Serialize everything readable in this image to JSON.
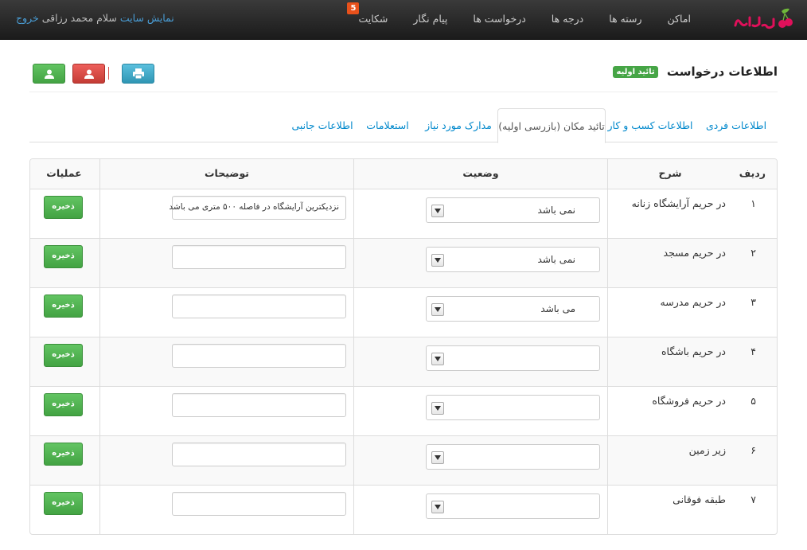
{
  "colors": {
    "navbar": "#222222",
    "link": "#0088cc",
    "success": "#46a546",
    "danger": "#c43c35",
    "info": "#2f96b4",
    "badge": "#e8511b"
  },
  "navbar": {
    "logo_text": "گیلاس",
    "menu": [
      {
        "label": "اماکن"
      },
      {
        "label": "رسته ها"
      },
      {
        "label": "درجه ها"
      },
      {
        "label": "درخواست ها"
      },
      {
        "label": "پیام نگار"
      },
      {
        "label": "شکایت",
        "badge": "5"
      }
    ],
    "user": {
      "show_site": "نمایش سایت",
      "greeting": "سلام محمد رزاقی",
      "logout": "خروج"
    }
  },
  "header": {
    "title": "اطلاعات درخواست",
    "badge": "تائید اولیه",
    "icons": [
      "print-icon",
      "user-icon",
      "user-icon"
    ]
  },
  "tabs": [
    {
      "label": "اطلاعات فردی",
      "active": false
    },
    {
      "label": "اطلاعات کسب و کار",
      "active": false
    },
    {
      "label": "تائید مکان (بازرسی اولیه)",
      "active": true
    },
    {
      "label": "مدارک مورد نیاز",
      "active": false
    },
    {
      "label": "استعلامات",
      "active": false
    },
    {
      "label": "اطلاعات جانبی",
      "active": false
    }
  ],
  "table": {
    "headers": {
      "num": "ردیف",
      "desc": "شرح",
      "status": "وضعیت",
      "notes": "توضیحات",
      "ops": "عملیات"
    },
    "save_label": "ذخیره",
    "rows": [
      {
        "num": "۱",
        "desc": "در حریم آرایشگاه زنانه",
        "status": "نمی باشد",
        "notes": "نزدیکترین آرایشگاه در فاصله ۵۰۰ متری می باشد"
      },
      {
        "num": "۲",
        "desc": "در حریم مسجد",
        "status": "نمی باشد",
        "notes": ""
      },
      {
        "num": "۳",
        "desc": "در حریم مدرسه",
        "status": "می باشد",
        "notes": ""
      },
      {
        "num": "۴",
        "desc": "در حریم باشگاه",
        "status": "",
        "notes": ""
      },
      {
        "num": "۵",
        "desc": "در حریم فروشگاه",
        "status": "",
        "notes": ""
      },
      {
        "num": "۶",
        "desc": "زیر زمین",
        "status": "",
        "notes": ""
      },
      {
        "num": "۷",
        "desc": "طبقه فوقانی",
        "status": "",
        "notes": ""
      }
    ]
  }
}
